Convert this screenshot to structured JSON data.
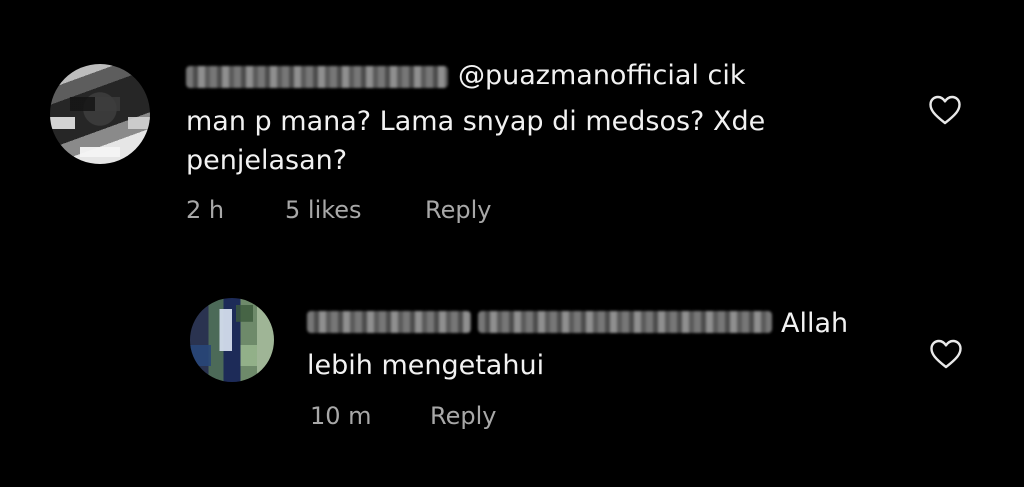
{
  "comments": [
    {
      "text_line1": "@puazmanofficial cik",
      "text_line2": "man p mana? Lama snyap di medsos? Xde",
      "text_line3": "penjelasan?",
      "time": "2 h",
      "likes": "5 likes",
      "reply_label": "Reply",
      "like_icon": "heart-outline-icon"
    },
    {
      "text_line1": "Allah",
      "text_line2": "lebih mengetahui",
      "time": "10 m",
      "reply_label": "Reply",
      "like_icon": "heart-outline-icon"
    }
  ],
  "colors": {
    "background": "#000000",
    "text": "#f2f2f2",
    "meta": "#a8a8a8"
  }
}
